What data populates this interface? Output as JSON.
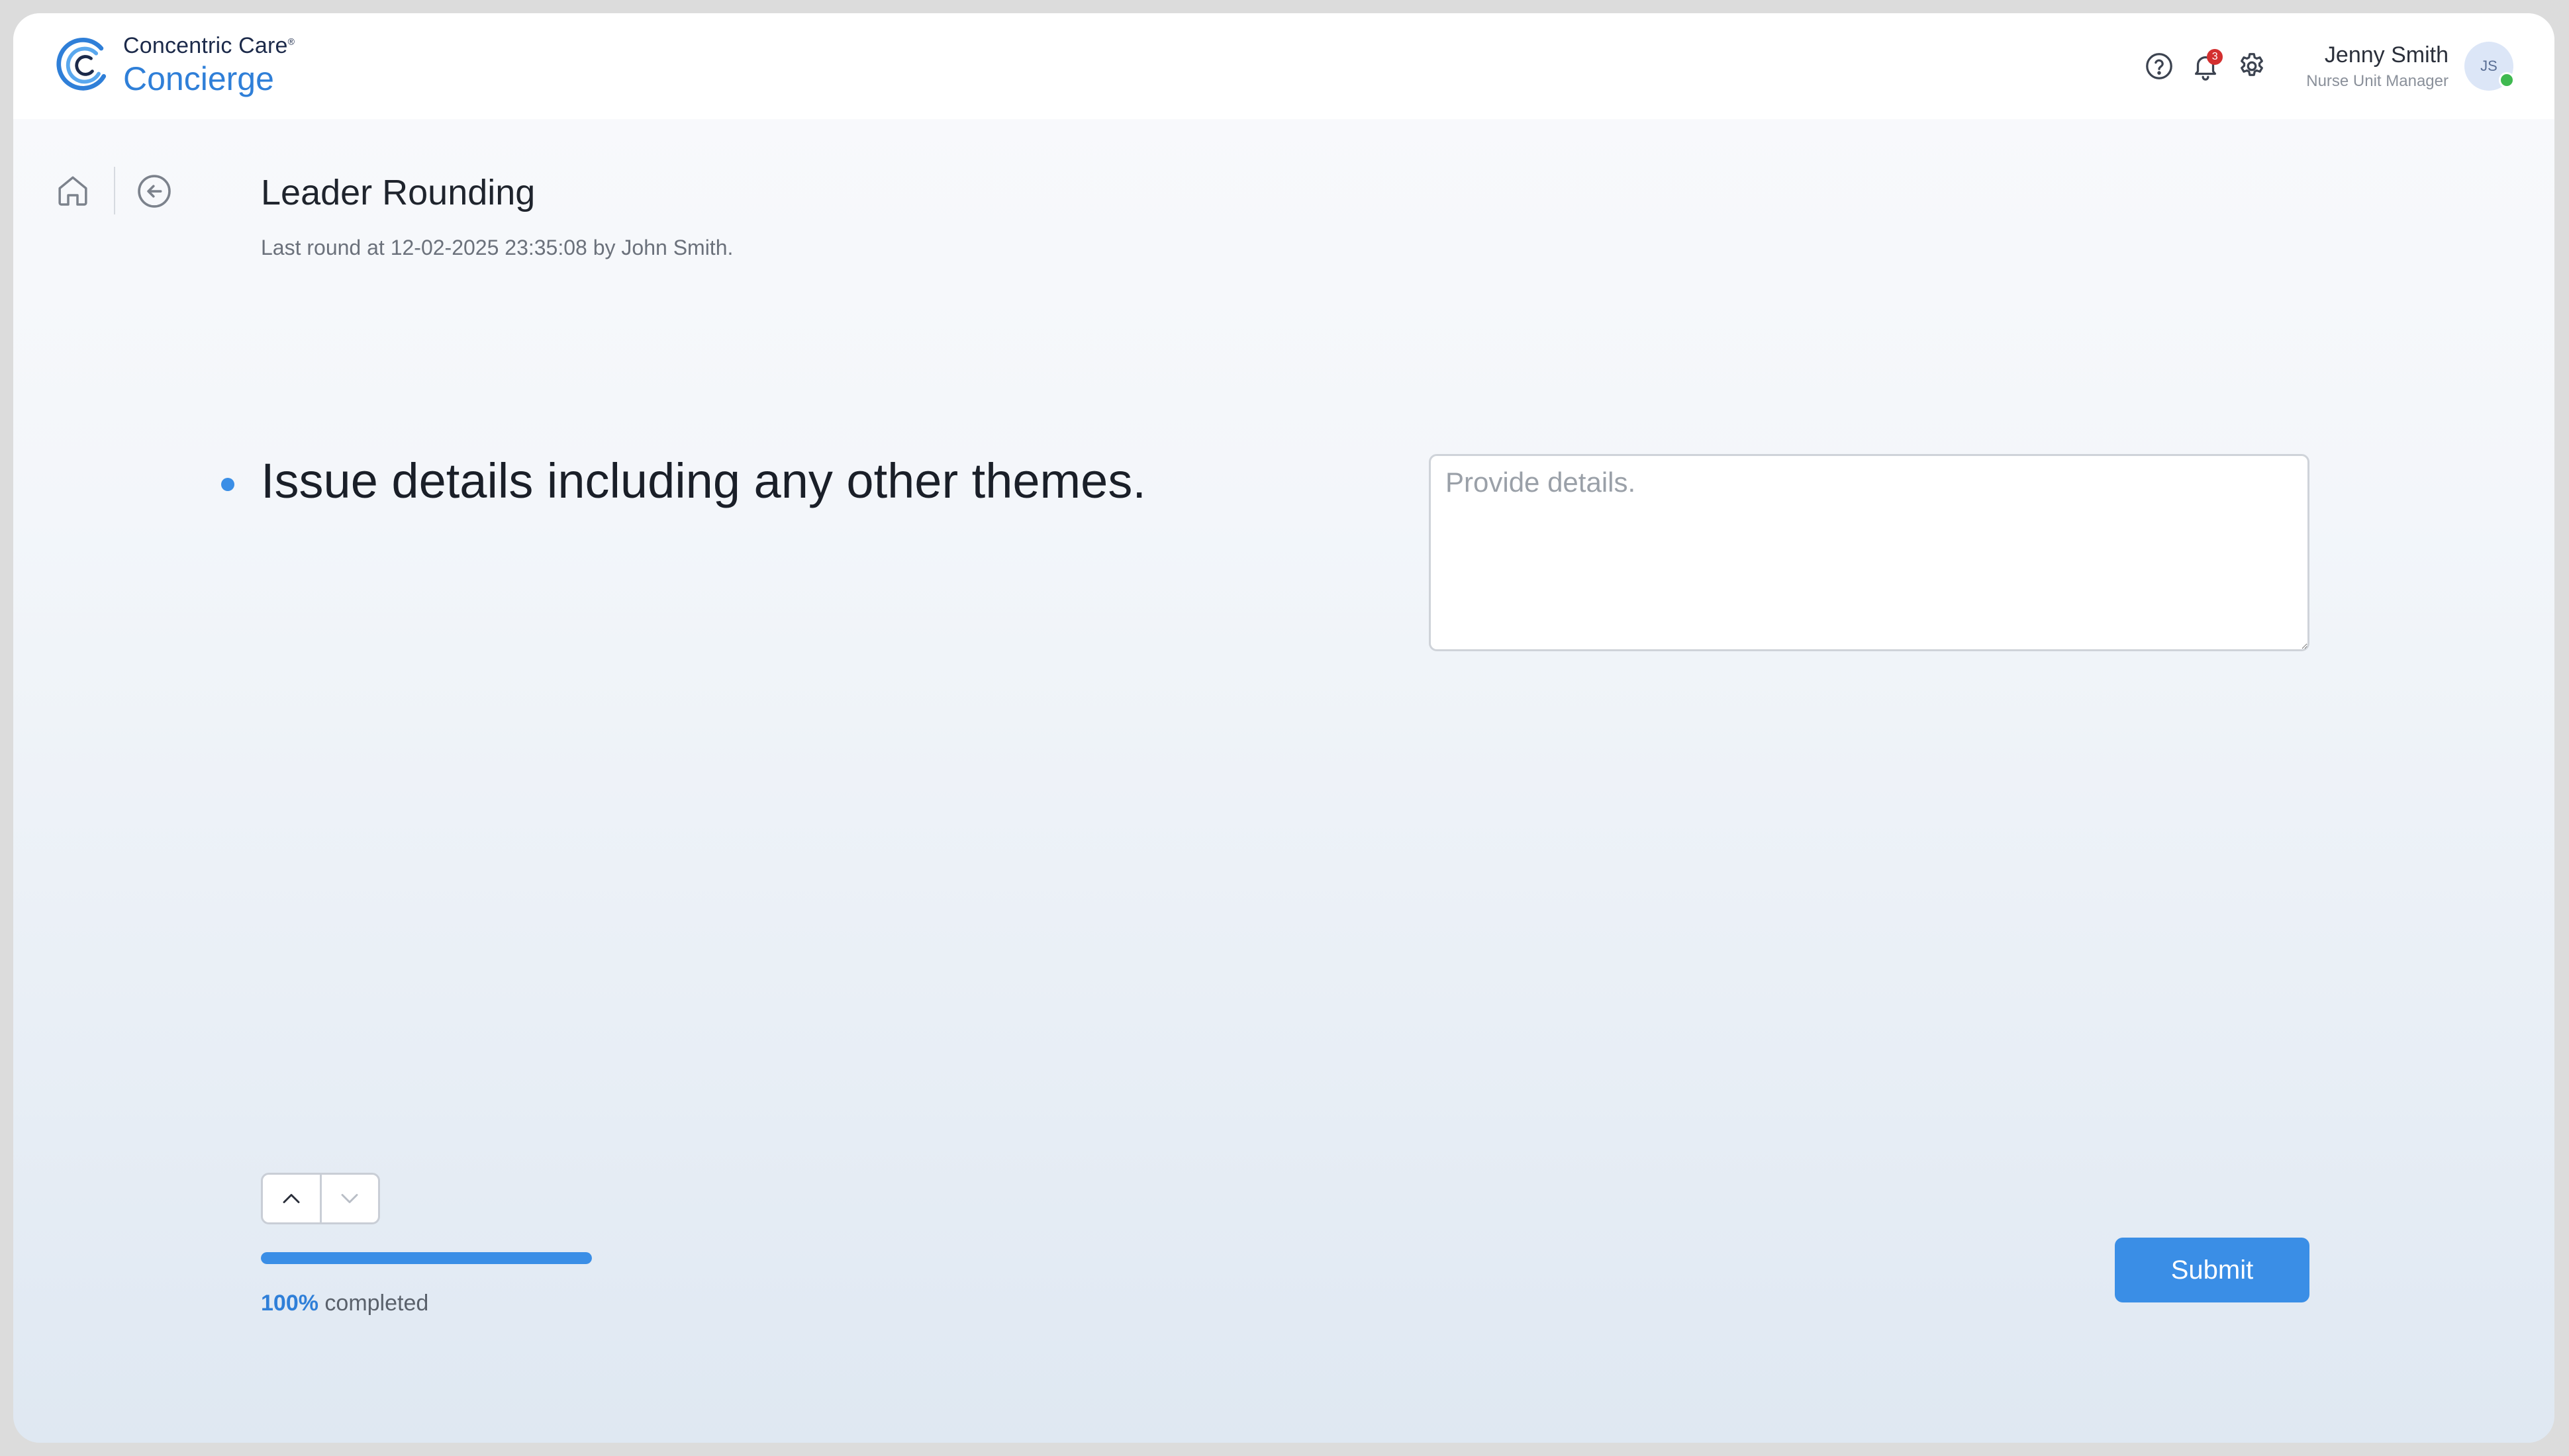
{
  "brand": {
    "top": "Concentric Care",
    "reg_mark": "®",
    "bottom": "Concierge"
  },
  "header": {
    "icons": [
      "help-icon",
      "bell-icon",
      "gear-icon"
    ],
    "notification_count": "3",
    "user_name": "Jenny Smith",
    "user_role": "Nurse Unit Manager",
    "avatar_initials": "JS",
    "status": "online"
  },
  "nav": {
    "icons": [
      "home-icon",
      "back-arrow-icon"
    ]
  },
  "page": {
    "title": "Leader Rounding",
    "subtitle": "Last round at 12-02-2025 23:35:08 by John Smith."
  },
  "question": {
    "text": "Issue details including any other themes.",
    "value": "",
    "placeholder": "Provide details."
  },
  "progress": {
    "percent": 100,
    "percent_label": "100%",
    "suffix": " completed"
  },
  "actions": {
    "submit_label": "Submit"
  },
  "colors": {
    "accent": "#3a8ee6",
    "brand_blue": "#2f7fd8",
    "badge_red": "#d32f2f",
    "online_green": "#3fb950"
  }
}
